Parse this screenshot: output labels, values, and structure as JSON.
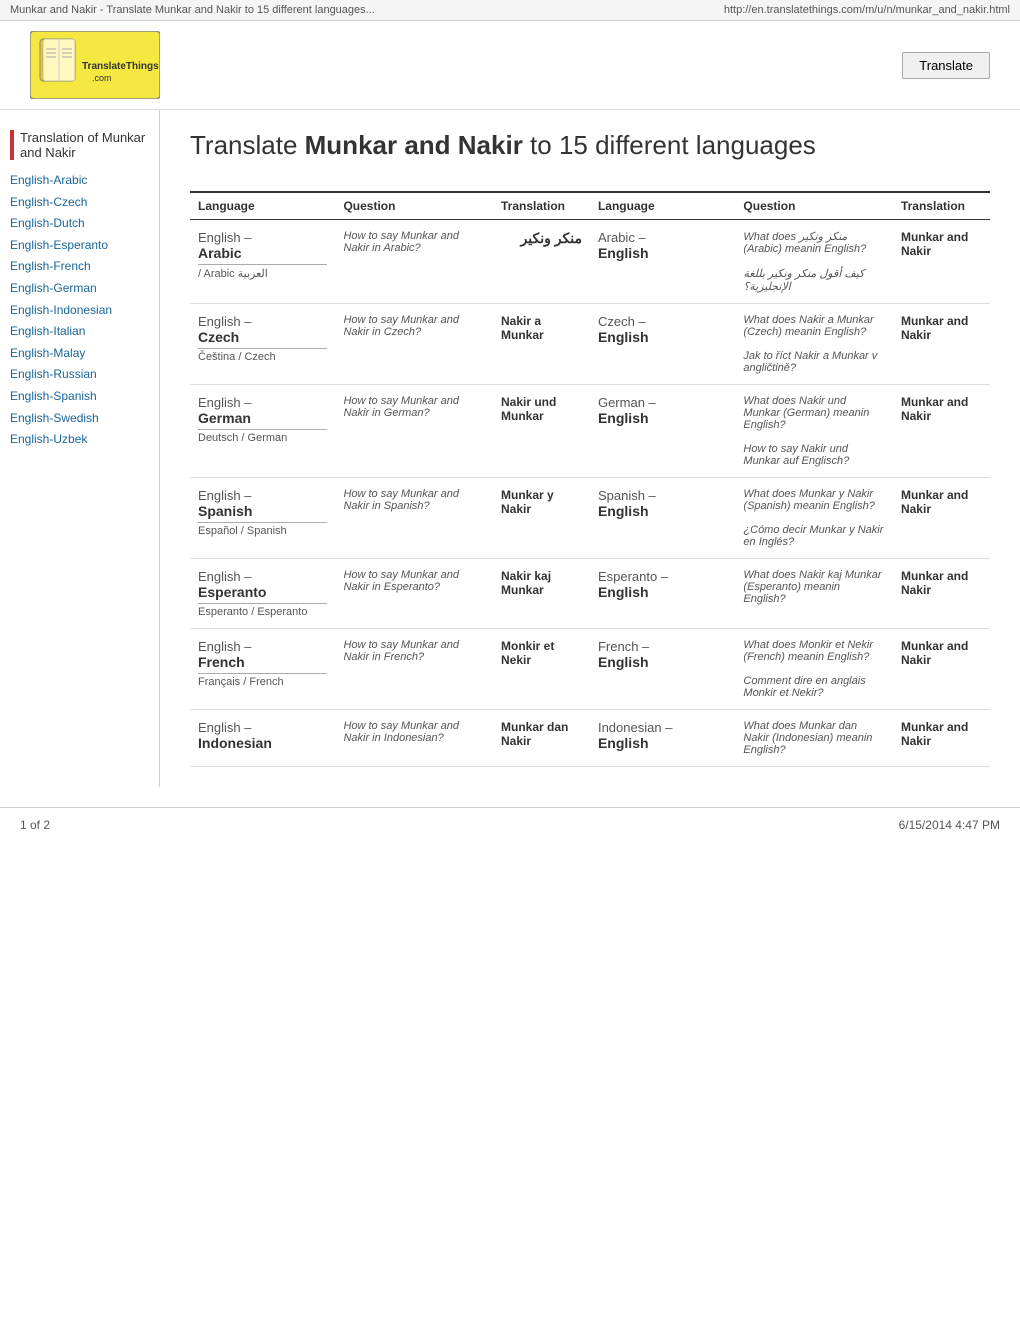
{
  "topbar": {
    "title": "Munkar and Nakir - Translate Munkar and Nakir to 15 different languages...",
    "url": "http://en.translatethings.com/m/u/n/munkar_and_nakir.html"
  },
  "header": {
    "logo_text": "TranslateThings.com",
    "translate_button": "Translate"
  },
  "sidebar": {
    "title": "Translation of Munkar and Nakir",
    "links": [
      "English-Arabic",
      "English-Czech",
      "English-Dutch",
      "English-Esperanto",
      "English-French",
      "English-German",
      "English-Indonesian",
      "English-Italian",
      "English-Malay",
      "English-Russian",
      "English-Spanish",
      "English-Swedish",
      "English-Uzbek"
    ]
  },
  "main": {
    "page_title_prefix": "Translate ",
    "page_title_bold": "Munkar and Nakir",
    "page_title_suffix": " to 15 different languages",
    "table_headers": [
      "Language",
      "Question",
      "Translation",
      "Language",
      "Question",
      "Translation"
    ],
    "rows": [
      {
        "lang_left": "English –\nArabic",
        "lang_left_subtitle": "/ Arabic\nالعربية",
        "question_left": "How to say Munkar and Nakir in Arabic?",
        "translation_left": "منكر ونكير",
        "lang_right": "Arabic –\nEnglish",
        "question_right_top": "What does منكر ونكير (Arabic) meanin English?",
        "question_right_bottom": "كيف أقول منكر ونكير بللغة الإنجليزية؟",
        "translation_right": "Munkar and Nakir"
      },
      {
        "lang_left": "English –\nCzech",
        "lang_left_subtitle": "Čeština / Czech",
        "question_left": "How to say Munkar and Nakir in Czech?",
        "translation_left": "Nakir a Munkar",
        "lang_right": "Czech –\nEnglish",
        "question_right_top": "What does Nakir a Munkar (Czech) meanin English?",
        "question_right_bottom": "Jak to říct Nakir a Munkar v angličtině?",
        "translation_right": "Munkar and Nakir"
      },
      {
        "lang_left": "English –\nGerman",
        "lang_left_subtitle": "Deutsch / German",
        "question_left": "How to say Munkar and Nakir in German?",
        "translation_left": "Nakir und Munkar",
        "lang_right": "German –\nEnglish",
        "question_right_top": "What does Nakir und Munkar (German) meanin English?",
        "question_right_bottom": "How to say Nakir und Munkar auf Englisch?",
        "translation_right": "Munkar and Nakir"
      },
      {
        "lang_left": "English –\nSpanish",
        "lang_left_subtitle": "Español / Spanish",
        "question_left": "How to say Munkar and Nakir in Spanish?",
        "translation_left": "Munkar y Nakir",
        "lang_right": "Spanish –\nEnglish",
        "question_right_top": "What does Munkar y Nakir (Spanish) meanin English?",
        "question_right_bottom": "¿Cómo decir Munkar y Nakir en Inglés?",
        "translation_right": "Munkar and Nakir"
      },
      {
        "lang_left": "English –\nEsperanto",
        "lang_left_subtitle": "Esperanto / Esperanto",
        "question_left": "How to say Munkar and Nakir in Esperanto?",
        "translation_left": "Nakir kaj Munkar",
        "lang_right": "Esperanto –\nEnglish",
        "question_right_top": "What does Nakir kaj Munkar (Esperanto) meanin English?",
        "question_right_bottom": "",
        "translation_right": "Munkar and Nakir"
      },
      {
        "lang_left": "English –\nFrench",
        "lang_left_subtitle": "Français / French",
        "question_left": "How to say Munkar and Nakir in French?",
        "translation_left": "Monkir et Nekir",
        "lang_right": "French –\nEnglish",
        "question_right_top": "What does Monkir et Nekir (French) meanin English?",
        "question_right_bottom": "Comment dire en anglais Monkir et Nekir?",
        "translation_right": "Munkar and Nakir"
      },
      {
        "lang_left": "English –\nIndonesian",
        "lang_left_subtitle": "",
        "question_left": "How to say Munkar and Nakir in Indonesian?",
        "translation_left": "Munkar dan Nakir",
        "lang_right": "Indonesian –\nEnglish",
        "question_right_top": "What does Munkar dan Nakir (Indonesian) meanin English?",
        "question_right_bottom": "",
        "translation_right": "Munkar and Nakir"
      }
    ]
  },
  "footer": {
    "page": "1 of 2",
    "date": "6/15/2014 4:47 PM"
  }
}
